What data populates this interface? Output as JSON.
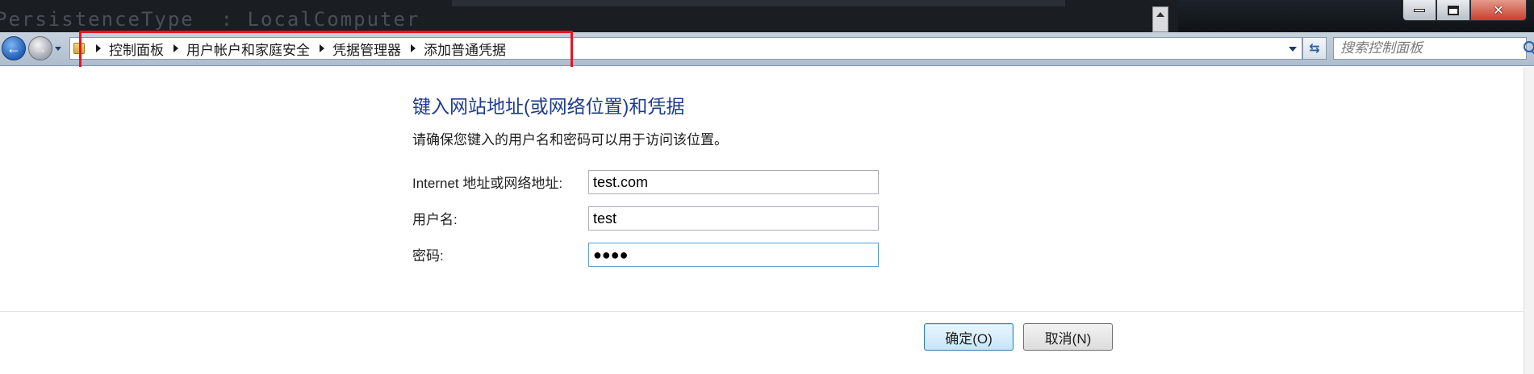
{
  "background_console": {
    "text": "PersistenceType  : LocalComputer"
  },
  "window": {
    "controls": {
      "minimize": "minimize",
      "maximize": "maximize",
      "close": "close"
    }
  },
  "breadcrumb": {
    "items": [
      "控制面板",
      "用户帐户和家庭安全",
      "凭据管理器",
      "添加普通凭据"
    ]
  },
  "search": {
    "placeholder": "搜索控制面板"
  },
  "form": {
    "heading": "键入网站地址(或网络位置)和凭据",
    "instruction": "请确保您键入的用户名和密码可以用于访问该位置。",
    "fields": [
      {
        "label": "Internet 地址或网络地址:",
        "value": "test.com"
      },
      {
        "label": "用户名:",
        "value": "test"
      },
      {
        "label": "密码:",
        "value": "●●●●"
      }
    ]
  },
  "buttons": {
    "ok": "确定(O)",
    "cancel": "取消(N)"
  },
  "colors": {
    "heading": "#1e3c8c",
    "highlight": "#e8141e"
  }
}
